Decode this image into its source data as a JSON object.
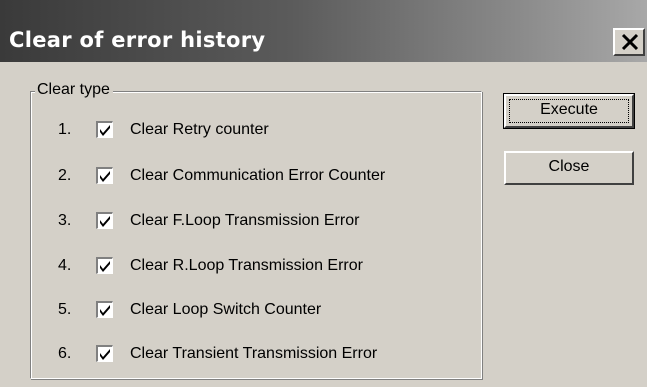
{
  "window": {
    "title": "Clear of error history"
  },
  "group": {
    "label": "Clear type",
    "items": [
      {
        "num": "1.",
        "label": "Clear Retry counter",
        "checked": true
      },
      {
        "num": "2.",
        "label": "Clear Communication Error Counter",
        "checked": true
      },
      {
        "num": "3.",
        "label": "Clear F.Loop Transmission Error",
        "checked": true
      },
      {
        "num": "4.",
        "label": "Clear R.Loop Transmission Error",
        "checked": true
      },
      {
        "num": "5.",
        "label": "Clear Loop Switch Counter",
        "checked": true
      },
      {
        "num": "6.",
        "label": "Clear Transient Transmission Error",
        "checked": true
      }
    ]
  },
  "buttons": {
    "execute": "Execute",
    "close": "Close"
  },
  "icons": {
    "close": "close-icon",
    "check": "checkmark-icon"
  },
  "colors": {
    "face": "#d4d0c8",
    "title_text": "#ffffff",
    "title_gradient_start": "#3a3a3a",
    "title_gradient_end": "#a8a8a8"
  }
}
